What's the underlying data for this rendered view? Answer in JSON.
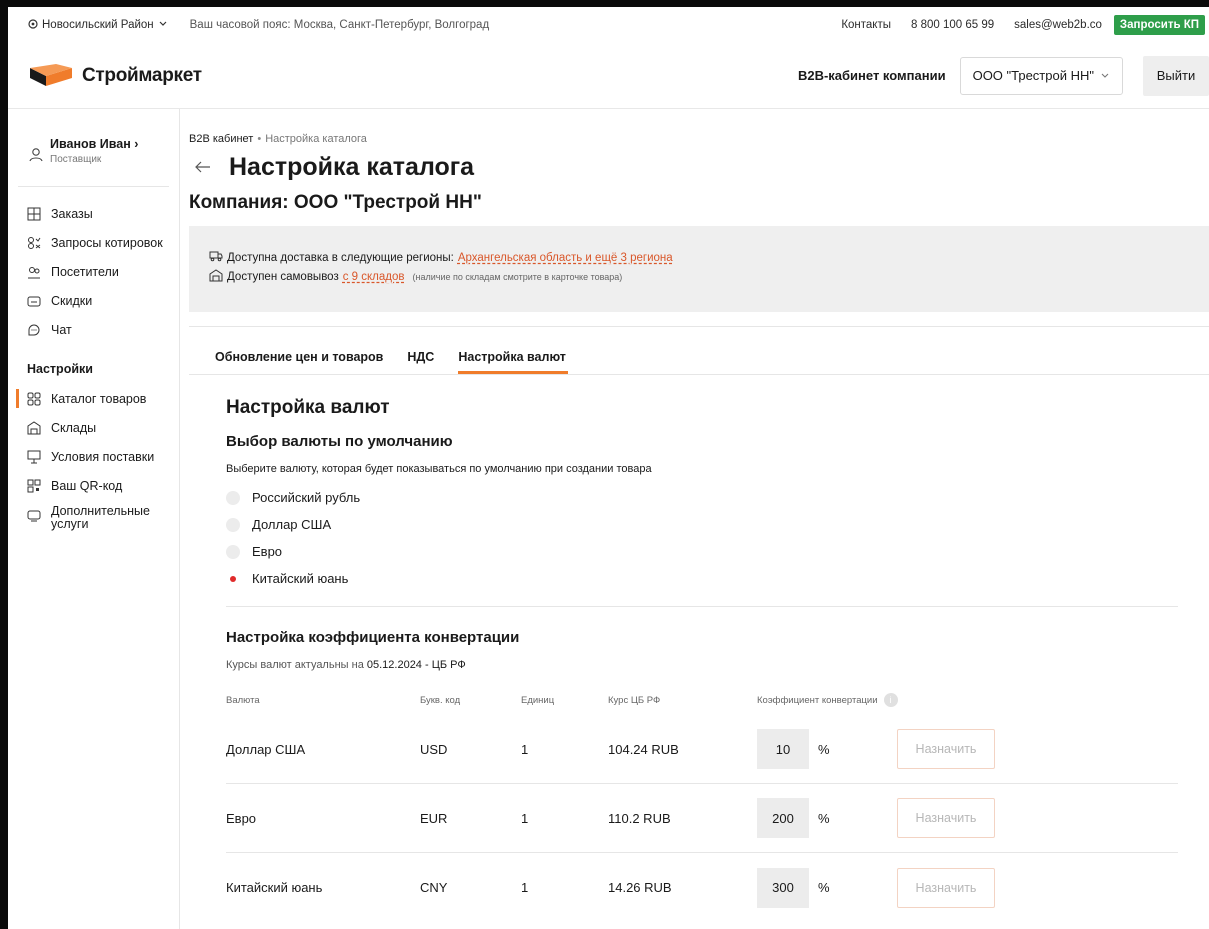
{
  "topbar": {
    "region": "Новосильский Район",
    "timezone": "Ваш часовой пояс: Москва, Санкт-Петербург, Волгоград",
    "contacts": "Контакты",
    "phone": "8 800 100 65 99",
    "email": "sales@web2b.co",
    "request_kp": "Запросить КП"
  },
  "header": {
    "logo_text": "Строймаркет",
    "b2b_label": "B2B-кабинет компании",
    "company_select": "ООО \"Трестрой НН\"",
    "logout": "Выйти"
  },
  "sidebar": {
    "user_name": "Иванов Иван",
    "user_role": "Поставщик",
    "items": [
      {
        "label": "Заказы",
        "icon": "orders-icon"
      },
      {
        "label": "Запросы котировок",
        "icon": "quotes-icon"
      },
      {
        "label": "Посетители",
        "icon": "visitors-icon"
      },
      {
        "label": "Скидки",
        "icon": "discounts-icon"
      },
      {
        "label": "Чат",
        "icon": "chat-icon"
      }
    ],
    "settings_title": "Настройки",
    "settings_items": [
      {
        "label": "Каталог товаров",
        "icon": "catalog-icon",
        "active": true
      },
      {
        "label": "Склады",
        "icon": "warehouse-icon"
      },
      {
        "label": "Условия поставки",
        "icon": "delivery-terms-icon"
      },
      {
        "label": "Ваш QR-код",
        "icon": "qr-code-icon"
      },
      {
        "label": "Дополнительные услуги",
        "icon": "services-icon"
      }
    ]
  },
  "breadcrumb": {
    "root": "B2B кабинет",
    "separator": "•",
    "current": "Настройка каталога"
  },
  "page": {
    "title": "Настройка каталога",
    "company": "Компания: ООО \"Трестрой НН\""
  },
  "info": {
    "delivery_text": "Доступна доставка в следующие регионы:",
    "delivery_link": "Архангельская область и ещё 3 региона",
    "pickup_text": "Доступен самовывоз",
    "pickup_link": "с 9 складов",
    "pickup_note": "(наличие по складам смотрите в карточке товара)"
  },
  "tabs": [
    {
      "label": "Обновление цен и товаров",
      "active": false
    },
    {
      "label": "НДС",
      "active": false
    },
    {
      "label": "Настройка валют",
      "active": true
    }
  ],
  "currency": {
    "heading": "Настройка валют",
    "default_heading": "Выбор валюты по умолчанию",
    "default_hint": "Выберите валюту, которая будет показываться по умолчанию при создании товара",
    "options": [
      {
        "label": "Российский рубль",
        "selected": false
      },
      {
        "label": "Доллар США",
        "selected": false
      },
      {
        "label": "Евро",
        "selected": false
      },
      {
        "label": "Китайский юань",
        "selected": true
      }
    ],
    "conversion_heading": "Настройка коэффициента конвертации",
    "rates_note_prefix": "Курсы валют актуальны на",
    "rates_note_value": "05.12.2024 - ЦБ РФ",
    "columns": {
      "currency": "Валюта",
      "code": "Букв. код",
      "units": "Единиц",
      "rate": "Курс ЦБ РФ",
      "coef": "Коэффициент конвертации"
    },
    "rows": [
      {
        "currency": "Доллар США",
        "code": "USD",
        "units": "1",
        "rate": "104.24 RUB",
        "coef": "10",
        "unit": "%",
        "action": "Назначить"
      },
      {
        "currency": "Евро",
        "code": "EUR",
        "units": "1",
        "rate": "110.2 RUB",
        "coef": "200",
        "unit": "%",
        "action": "Назначить"
      },
      {
        "currency": "Китайский юань",
        "code": "CNY",
        "units": "1",
        "rate": "14.26 RUB",
        "coef": "300",
        "unit": "%",
        "action": "Назначить"
      }
    ]
  },
  "colors": {
    "accent": "#f07c2b",
    "link": "#d9572a",
    "request_button": "#2e9e4a",
    "radio_selected": "#e02b2b"
  }
}
